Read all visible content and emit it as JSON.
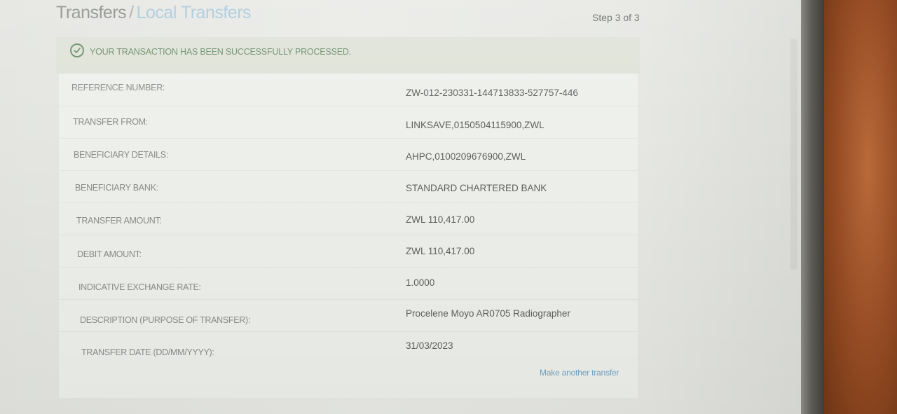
{
  "header": {
    "title": "Transfers",
    "separator": "/",
    "breadcrumb": "Local Transfers",
    "step": "Step 3 of 3"
  },
  "banner": {
    "icon": "check-circle-icon",
    "text": "YOUR TRANSACTION HAS BEEN SUCCESSFULLY PROCESSED."
  },
  "details": [
    {
      "label": "REFERENCE NUMBER:",
      "value": "ZW-012-230331-144713833-527757-446"
    },
    {
      "label": "TRANSFER FROM:",
      "value": "LINKSAVE,0150504115900,ZWL"
    },
    {
      "label": "BENEFICIARY DETAILS:",
      "value": "AHPC,0100209676900,ZWL"
    },
    {
      "label": "BENEFICIARY BANK:",
      "value": "STANDARD CHARTERED BANK"
    },
    {
      "label": "TRANSFER AMOUNT:",
      "value": "ZWL 110,417.00"
    },
    {
      "label": "DEBIT AMOUNT:",
      "value": "ZWL 110,417.00"
    },
    {
      "label": "INDICATIVE EXCHANGE RATE:",
      "value": "1.0000"
    },
    {
      "label": "DESCRIPTION (PURPOSE OF TRANSFER):",
      "value": "Procelene Moyo AR0705 Radiographer"
    },
    {
      "label": "TRANSFER DATE (DD/MM/YYYY):",
      "value": "31/03/2023"
    }
  ],
  "actions": {
    "make_another": "Make another transfer"
  },
  "colors": {
    "success": "#6f8f6d",
    "link": "#6fa4c8",
    "breadcrumb": "#a8c9dc"
  }
}
